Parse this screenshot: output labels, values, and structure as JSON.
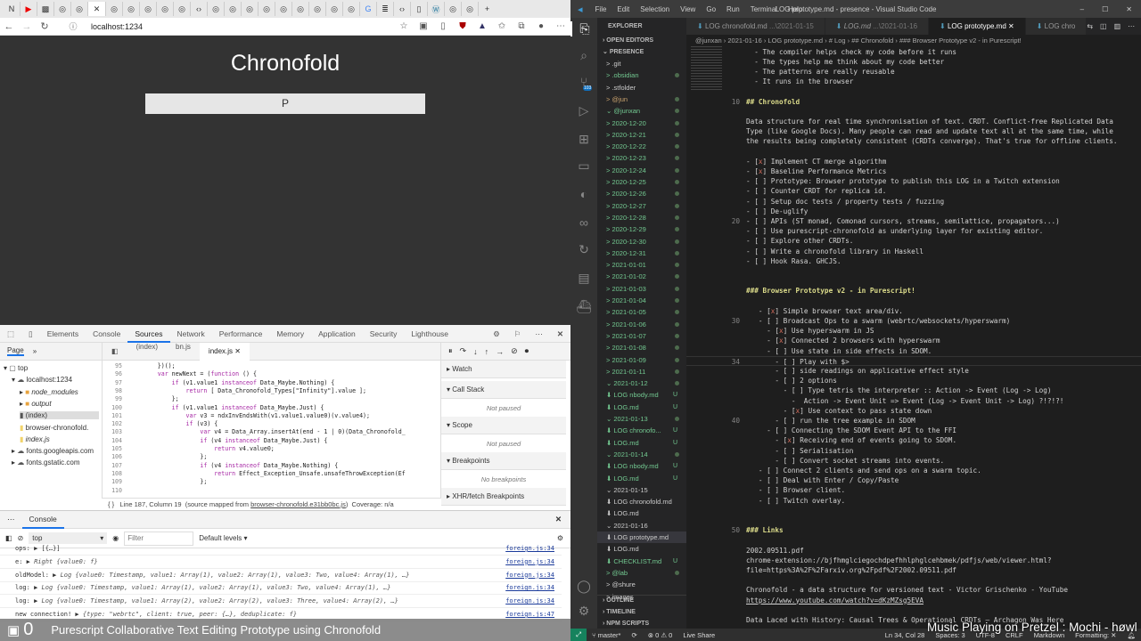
{
  "browser": {
    "tab_icons": [
      "notion",
      "youtube",
      "minecraft",
      "github",
      "github",
      "active-close",
      "github",
      "github",
      "github",
      "github",
      "github",
      "code",
      "github",
      "github",
      "github",
      "github",
      "github",
      "github",
      "github",
      "github",
      "github",
      "google",
      "stack",
      "code",
      "document",
      "wordpress",
      "github",
      "github"
    ],
    "new_tab": "+",
    "url": "localhost:1234",
    "page": {
      "title": "Chronofold",
      "input_value": "P"
    }
  },
  "devtools": {
    "tabs": [
      "Elements",
      "Console",
      "Sources",
      "Network",
      "Performance",
      "Memory",
      "Application",
      "Security",
      "Lighthouse"
    ],
    "selected_tab": "Sources",
    "nav": {
      "tabs": [
        "Page",
        "»"
      ],
      "tree": [
        {
          "label": "top",
          "icon": "frame",
          "level": 0
        },
        {
          "label": "localhost:1234",
          "icon": "cloud",
          "level": 1
        },
        {
          "label": "node_modules",
          "icon": "folder",
          "level": 2
        },
        {
          "label": "output",
          "icon": "folder",
          "level": 2
        },
        {
          "label": "(index)",
          "icon": "file",
          "level": 2
        },
        {
          "label": "browser-chronofold.",
          "icon": "file-js",
          "level": 2
        },
        {
          "label": "index.js",
          "icon": "file-js",
          "level": 2
        },
        {
          "label": "fonts.googleapis.com",
          "icon": "cloud",
          "level": 1
        },
        {
          "label": "fonts.gstatic.com",
          "icon": "cloud",
          "level": 1
        }
      ]
    },
    "editor_tabs": [
      "(index)",
      "bn.js",
      "index.js"
    ],
    "code": [
      {
        "n": "95",
        "t": "        })();"
      },
      {
        "n": "96",
        "t": "        var newNext = (function () {"
      },
      {
        "n": "97",
        "t": "            if (v1.value1 instanceof Data_Maybe.Nothing) {"
      },
      {
        "n": "98",
        "t": "                return [ Data_Chronofold_Types[\"Infinity\"].value ];"
      },
      {
        "n": "99",
        "t": "            };"
      },
      {
        "n": "100",
        "t": "            if (v1.value1 instanceof Data_Maybe.Just) {"
      },
      {
        "n": "101",
        "t": "                var v3 = ndxInvEndsWith(v1.value1.value0)(v.value4);"
      },
      {
        "n": "102",
        "t": "                if (v3) {"
      },
      {
        "n": "103",
        "t": "                    var v4 = Data_Array.insertAt(end - 1 | 0)(Data_Chronofold_"
      },
      {
        "n": "104",
        "t": "                    if (v4 instanceof Data_Maybe.Just) {"
      },
      {
        "n": "105",
        "t": "                        return v4.value0;"
      },
      {
        "n": "106",
        "t": "                    };"
      },
      {
        "n": "107",
        "t": "                    if (v4 instanceof Data_Maybe.Nothing) {"
      },
      {
        "n": "108",
        "t": "                        return Effect_Exception_Unsafe.unsafeThrowException(Ef"
      },
      {
        "n": "109",
        "t": "                    };"
      },
      {
        "n": "110",
        "t": ""
      }
    ],
    "debugger": {
      "sections": [
        "Watch",
        "Call Stack",
        "Scope",
        "Breakpoints",
        "XHR/fetch Breakpoints"
      ],
      "not_paused": "Not paused",
      "not_paused2": "Not paused",
      "no_breakpoints": "No breakpoints"
    },
    "status": {
      "position": "Line 187, Column 19",
      "mapped_prefix": "(source mapped from ",
      "mapped_file": "browser-chronofold.e31bb0bc.js",
      "mapped_suffix": ")",
      "coverage": "Coverage: n/a"
    },
    "console": {
      "tab": "Console",
      "context": "top",
      "filter_placeholder": "Filter",
      "levels": "Default levels ▾",
      "messages": [
        {
          "label": "ops: ▶ [{…}]",
          "body": "",
          "src": "foreign.js:34"
        },
        {
          "label": "e: ▶",
          "body": "Right {value0: f}",
          "src": "foreign.js:34"
        },
        {
          "label": "oldModel: ▶",
          "body": "Log {value0: Timestamp, value1: Array(1), value2: Array(1), value3: Two, value4: Array(1), …}",
          "src": "foreign.js:34"
        },
        {
          "label": "log: ▶",
          "body": "Log {value0: Timestamp, value1: Array(1), value2: Array(1), value3: Two, value4: Array(1), …}",
          "src": "foreign.js:34"
        },
        {
          "label": "log: ▶",
          "body": "Log {value0: Timestamp, value1: Array(2), value2: Array(2), value3: Three, value4: Array(2), …}",
          "src": "foreign.js:34"
        },
        {
          "label": "new connection! ▶",
          "body": "{type: \"webrtc\", client: true, peer: {…}, deduplicate: f}",
          "src": "foreign.js:47"
        }
      ]
    }
  },
  "overlay": {
    "twitch_count": "0",
    "stream_title": "Purescript Collaborative Text Editing Prototype using Chronofold",
    "music": "Music Playing on Pretzel : Mochi - høwl"
  },
  "vscode": {
    "menu": [
      "File",
      "Edit",
      "Selection",
      "View",
      "Go",
      "Run",
      "Terminal",
      "Help"
    ],
    "title": "LOG prototype.md - presence - Visual Studio Code",
    "scm_badge": "103",
    "explorer": {
      "title": "EXPLORER",
      "open_editors": "OPEN EDITORS",
      "root": "PRESENCE",
      "items": [
        {
          "t": "> .git",
          "c": ""
        },
        {
          "t": "> .obsidian",
          "c": "green",
          "d": 1
        },
        {
          "t": "> .stfolder",
          "c": ""
        },
        {
          "t": "> @jun",
          "c": "brown",
          "d": 1
        },
        {
          "t": "⌄ @junxan",
          "c": "green",
          "d": 1
        },
        {
          "t": "  > 2020-12-20",
          "c": "green",
          "d": 1
        },
        {
          "t": "  > 2020-12-21",
          "c": "green",
          "d": 1
        },
        {
          "t": "  > 2020-12-22",
          "c": "green",
          "d": 1
        },
        {
          "t": "  > 2020-12-23",
          "c": "green",
          "d": 1
        },
        {
          "t": "  > 2020-12-24",
          "c": "green",
          "d": 1
        },
        {
          "t": "  > 2020-12-25",
          "c": "green",
          "d": 1
        },
        {
          "t": "  > 2020-12-26",
          "c": "green",
          "d": 1
        },
        {
          "t": "  > 2020-12-27",
          "c": "green",
          "d": 1
        },
        {
          "t": "  > 2020-12-28",
          "c": "green",
          "d": 1
        },
        {
          "t": "  > 2020-12-29",
          "c": "green",
          "d": 1
        },
        {
          "t": "  > 2020-12-30",
          "c": "green",
          "d": 1
        },
        {
          "t": "  > 2020-12-31",
          "c": "green",
          "d": 1
        },
        {
          "t": "  > 2021-01-01",
          "c": "green",
          "d": 1
        },
        {
          "t": "  > 2021-01-02",
          "c": "green",
          "d": 1
        },
        {
          "t": "  > 2021-01-03",
          "c": "green",
          "d": 1
        },
        {
          "t": "  > 2021-01-04",
          "c": "green",
          "d": 1
        },
        {
          "t": "  > 2021-01-05",
          "c": "green",
          "d": 1
        },
        {
          "t": "  > 2021-01-06",
          "c": "green",
          "d": 1
        },
        {
          "t": "  > 2021-01-07",
          "c": "green",
          "d": 1
        },
        {
          "t": "  > 2021-01-08",
          "c": "green",
          "d": 1
        },
        {
          "t": "  > 2021-01-09",
          "c": "green",
          "d": 1
        },
        {
          "t": "  > 2021-01-11",
          "c": "green",
          "d": 1
        },
        {
          "t": "  ⌄ 2021-01-12",
          "c": "green",
          "d": 1
        },
        {
          "t": "    ⬇ LOG nbody.md",
          "c": "green",
          "u": "U"
        },
        {
          "t": "    ⬇ LOG.md",
          "c": "green",
          "u": "U"
        },
        {
          "t": "  ⌄ 2021-01-13",
          "c": "green",
          "d": 1
        },
        {
          "t": "    ⬇ LOG chronofo...",
          "c": "green",
          "u": "U"
        },
        {
          "t": "    ⬇ LOG.md",
          "c": "green",
          "u": "U"
        },
        {
          "t": "  ⌄ 2021-01-14",
          "c": "green",
          "d": 1
        },
        {
          "t": "    ⬇ LOG nbody.md",
          "c": "green",
          "u": "U"
        },
        {
          "t": "    ⬇ LOG.md",
          "c": "green",
          "u": "U"
        },
        {
          "t": "  ⌄ 2021-01-15",
          "c": ""
        },
        {
          "t": "    ⬇ LOG chronofold.md",
          "c": ""
        },
        {
          "t": "    ⬇ LOG.md",
          "c": ""
        },
        {
          "t": "  ⌄ 2021-01-16",
          "c": ""
        },
        {
          "t": "    ⬇ LOG prototype.md",
          "c": "",
          "sel": 1
        },
        {
          "t": "    ⬇ LOG.md",
          "c": ""
        },
        {
          "t": "  ⬇ CHECKLIST.md",
          "c": "green",
          "u": "U"
        },
        {
          "t": "> @lab",
          "c": "green",
          "d": 1
        },
        {
          "t": "> @shure",
          "c": ""
        },
        {
          "t": "> images",
          "c": ""
        }
      ],
      "panels": [
        "OUTLINE",
        "TIMELINE",
        "NPM SCRIPTS"
      ]
    },
    "tabs": [
      {
        "label": "LOG chronofold.md",
        "hint": "...\\2021-01-15"
      },
      {
        "label": "LOG.md",
        "hint": "...\\2021-01-16"
      },
      {
        "label": "LOG prototype.md",
        "hint": "",
        "selected": true
      },
      {
        "label": "LOG chro",
        "hint": ""
      }
    ],
    "breadcrumb": "@junxan › 2021-01-16 › LOG prototype.md › # Log › ## Chronofold › ### Browser Prototype v2 - in Purescript!",
    "lines": [
      {
        "t": "  - The compiler helps check my code before it runs"
      },
      {
        "t": "  - The types help me think about my code better"
      },
      {
        "t": "  - The patterns are really reusable"
      },
      {
        "t": "  - It runs in the browser"
      },
      {
        "t": ""
      },
      {
        "n": "10",
        "t": "## Chronofold",
        "h": 1
      },
      {
        "t": ""
      },
      {
        "t": "Data structure for real time synchronisation of text. CRDT. Conflict-free Replicated Data"
      },
      {
        "t": "Type (like Google Docs). Many people can read and update text all at the same time, while"
      },
      {
        "t": "the results being completely consistent (CRDTs converge). That's true for offline clients."
      },
      {
        "t": ""
      },
      {
        "t": "- [x] Implement CT merge algorithm"
      },
      {
        "t": "- [x] Baseline Performance Metrics"
      },
      {
        "t": "- [ ] Prototype: Browser prototype to publish this LOG in a Twitch extension"
      },
      {
        "t": "- [ ] Counter CRDT for replica id."
      },
      {
        "t": "- [ ] Setup doc tests / property tests / fuzzing"
      },
      {
        "t": "- [ ] De-uglify"
      },
      {
        "n": "20",
        "t": "- [ ] APIs (ST monad, Comonad cursors, streams, semilattice, propagators...)"
      },
      {
        "t": "- [ ] Use purescript-chronofold as underlying layer for existing editor."
      },
      {
        "t": "- [ ] Explore other CRDTs."
      },
      {
        "t": "- [ ] Write a chronofold library in Haskell"
      },
      {
        "t": "- [ ] Hook Rasa. GHCJS."
      },
      {
        "t": ""
      },
      {
        "t": ""
      },
      {
        "t": "### Browser Prototype v2 - in Purescript!",
        "h": 1
      },
      {
        "t": ""
      },
      {
        "t": "   - [x] Simple browser text area/div."
      },
      {
        "n": "30",
        "t": "   - [ ] Broadcast Ops to a swarm (webrtc/websockets/hyperswarm)"
      },
      {
        "t": "     - [x] Use hyperswarm in JS"
      },
      {
        "t": "     - [x] Connected 2 browsers with hyperswarm"
      },
      {
        "t": "     - [ ] Use state in side effects in SDOM."
      },
      {
        "n": "34",
        "t": "       - [ ] Play with $>",
        "cur": 1
      },
      {
        "t": "       - [ ] side readings on applicative effect style"
      },
      {
        "t": "       - [ ] 2 options"
      },
      {
        "t": "         - [ ] Type tetris the interpreter :: Action -> Event (Log -> Log)"
      },
      {
        "t": "           -  Action -> Event Unit => Event (Log -> Event Unit -> Log) ?!?!?!"
      },
      {
        "t": "         - [x] Use context to pass state down"
      },
      {
        "n": "40",
        "t": "       - [ ] run the tree example in SDOM"
      },
      {
        "t": "     - [ ] Connecting the SDOM Event API to the FFI"
      },
      {
        "t": "       - [x] Receiving end of events going to SDOM."
      },
      {
        "t": "       - [ ] Serialisation"
      },
      {
        "t": "       - [ ] Convert socket streams into events."
      },
      {
        "t": "   - [ ] Connect 2 clients and send ops on a swarm topic."
      },
      {
        "t": "   - [ ] Deal with Enter / Copy/Paste"
      },
      {
        "t": "   - [ ] Browser client."
      },
      {
        "t": "   - [ ] Twitch overlay."
      },
      {
        "t": ""
      },
      {
        "t": ""
      },
      {
        "n": "50",
        "t": "### Links",
        "h": 1
      },
      {
        "t": ""
      },
      {
        "t": "2002.09511.pdf"
      },
      {
        "t": "chrome-extension://bjfhmglciegochdpefhhlphglcehbmek/pdfjs/web/viewer.html?"
      },
      {
        "t": "file=https%3A%2F%2Farxiv.org%2Fpdf%2F2002.09511.pdf"
      },
      {
        "t": ""
      },
      {
        "t": "Chronofold - a data structure for versioned text - Victor Grischenko - YouTube"
      },
      {
        "t": "https://www.youtube.com/watch?v=dKzMZsg5EVA",
        "link": 1
      },
      {
        "t": ""
      },
      {
        "t": "Data Laced with History: Causal Trees & Operational CRDTs — Archagon Was Here"
      }
    ],
    "status": {
      "branch": "master*",
      "sync": "⟳",
      "problems": "⊗ 0 ⚠ 0",
      "live_share": "Live Share",
      "position": "Ln 34, Col 28",
      "spaces": "Spaces: 3",
      "encoding": "UTF-8",
      "eol": "CRLF",
      "language": "Markdown",
      "formatting": "Formatting: ✕"
    }
  }
}
